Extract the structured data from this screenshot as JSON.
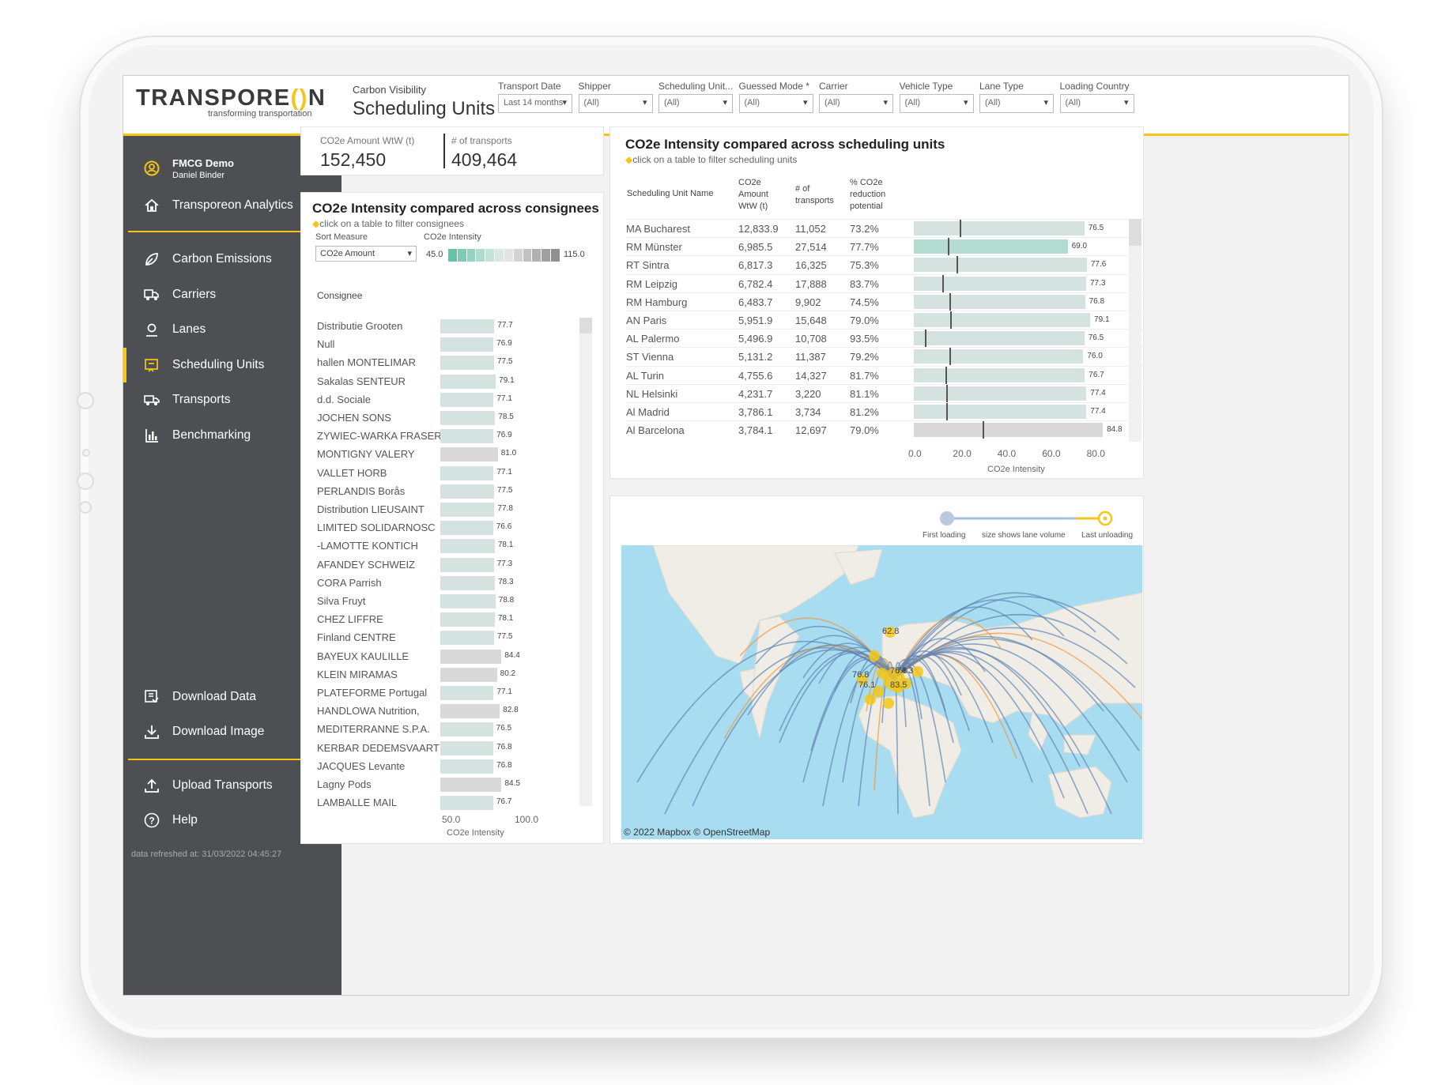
{
  "brand": {
    "logo_pre": "TRANSPORE",
    "logo_o": "()",
    "logo_post": "N",
    "tagline": "transforming transportation"
  },
  "page": {
    "subtitle": "Carbon Visibility",
    "title": "Scheduling Units"
  },
  "filters": [
    {
      "label": "Transport Date",
      "value": "Last 14 months"
    },
    {
      "label": "Shipper",
      "value": "(All)"
    },
    {
      "label": "Scheduling Unit...",
      "value": "(All)"
    },
    {
      "label": "Guessed Mode *",
      "value": "(All)"
    },
    {
      "label": "Carrier",
      "value": "(All)"
    },
    {
      "label": "Vehicle Type",
      "value": "(All)"
    },
    {
      "label": "Lane Type",
      "value": "(All)"
    },
    {
      "label": "Loading Country",
      "value": "(All)"
    }
  ],
  "user": {
    "org": "FMCG Demo",
    "name": "Daniel Binder"
  },
  "nav": {
    "home": "Transporeon Analytics",
    "items": [
      "Carbon Emissions",
      "Carriers",
      "Lanes",
      "Scheduling Units",
      "Transports",
      "Benchmarking"
    ],
    "active": "Scheduling Units",
    "download_data": "Download Data",
    "download_image": "Download Image",
    "upload": "Upload Transports",
    "help": "Help"
  },
  "refresh": "data refreshed at: 31/03/2022 04:45:27",
  "kpis": [
    {
      "label": "CO2e Amount WtW (t)",
      "value": "152,450"
    },
    {
      "label": "# of transports",
      "value": "409,464"
    }
  ],
  "consignees": {
    "title": "CO2e Intensity compared across consignees",
    "hint": "click on a table to filter consignees",
    "sort_label": "Sort Measure",
    "sort_value": "CO2e Amount",
    "legend_label": "CO2e Intensity",
    "legend_min": "45.0",
    "legend_max": "115.0",
    "col_header": "Consignee",
    "axis_ticks": [
      "50.0",
      "100.0"
    ],
    "axis_title": "CO2e Intensity",
    "rows": [
      {
        "name": "Distributie Grooten",
        "value": 77.7,
        "label": "77.7"
      },
      {
        "name": "Null",
        "value": 76.9,
        "label": "76.9"
      },
      {
        "name": "hallen MONTELIMAR",
        "value": 77.5,
        "label": "77.5"
      },
      {
        "name": "Sakalas SENTEUR",
        "value": 79.1,
        "label": "79.1"
      },
      {
        "name": "d.d. Sociale",
        "value": 77.1,
        "label": "77.1"
      },
      {
        "name": "JOCHEN SONS",
        "value": 78.5,
        "label": "78.5"
      },
      {
        "name": "ZYWIEC-WARKA FRASER",
        "value": 76.9,
        "label": "76.9"
      },
      {
        "name": "MONTIGNY VALERY",
        "value": 81.0,
        "label": "81.0",
        "grey": true
      },
      {
        "name": "VALLET HORB",
        "value": 77.1,
        "label": "77.1"
      },
      {
        "name": "PERLANDIS Borås",
        "value": 77.5,
        "label": "77.5"
      },
      {
        "name": "Distribution LIEUSAINT",
        "value": 77.8,
        "label": "77.8"
      },
      {
        "name": "LIMITED SOLIDARNOSC",
        "value": 76.6,
        "label": "76.6"
      },
      {
        "name": "-LAMOTTE KONTICH",
        "value": 78.1,
        "label": "78.1"
      },
      {
        "name": "AFANDEY SCHWEIZ",
        "value": 77.3,
        "label": "77.3"
      },
      {
        "name": "CORA Parrish",
        "value": 78.3,
        "label": "78.3"
      },
      {
        "name": "Silva Fruyt",
        "value": 78.8,
        "label": "78.8"
      },
      {
        "name": "CHEZ LIFFRE",
        "value": 78.1,
        "label": "78.1"
      },
      {
        "name": "Finland CENTRE",
        "value": 77.5,
        "label": "77.5"
      },
      {
        "name": "BAYEUX KAULILLE",
        "value": 84.4,
        "label": "84.4",
        "grey": true
      },
      {
        "name": "KLEIN MIRAMAS",
        "value": 80.2,
        "label": "80.2",
        "grey": true
      },
      {
        "name": "PLATEFORME Portugal",
        "value": 77.1,
        "label": "77.1"
      },
      {
        "name": "HANDLOWA Nutrition,",
        "value": 82.8,
        "label": "82.8",
        "grey": true
      },
      {
        "name": "MEDITERRANNE S.P.A.",
        "value": 76.5,
        "label": "76.5"
      },
      {
        "name": "KERBAR DEDEMSVAART",
        "value": 76.8,
        "label": "76.8"
      },
      {
        "name": "JACQUES Levante",
        "value": 76.8,
        "label": "76.8"
      },
      {
        "name": "Lagny Pods",
        "value": 84.5,
        "label": "84.5",
        "grey": true
      },
      {
        "name": "LAMBALLE MAIL",
        "value": 76.7,
        "label": "76.7"
      }
    ]
  },
  "units": {
    "title": "CO2e Intensity compared across scheduling units",
    "hint": "click on a table to filter scheduling units",
    "headers": {
      "name": "Scheduling Unit Name",
      "amount": "CO2e Amount WtW (t)",
      "transports": "# of transports",
      "reduction": "% CO2e reduction potential"
    },
    "axis_ticks": [
      "0.0",
      "20.0",
      "40.0",
      "60.0",
      "80.0"
    ],
    "axis_title": "CO2e Intensity",
    "rows": [
      {
        "name": "MA Bucharest",
        "amount": "12,833.9",
        "transports": "11,052",
        "reduction": "73.2%",
        "value": 76.5,
        "label": "76.5",
        "ref": 20.5
      },
      {
        "name": "RM Münster",
        "amount": "6,985.5",
        "transports": "27,514",
        "reduction": "77.7%",
        "value": 69.0,
        "label": "69.0",
        "ref": 15.4,
        "hl": true
      },
      {
        "name": "RT Sintra",
        "amount": "6,817.3",
        "transports": "16,325",
        "reduction": "75.3%",
        "value": 77.6,
        "label": "77.6",
        "ref": 19.2
      },
      {
        "name": "RM Leipzig",
        "amount": "6,782.4",
        "transports": "17,888",
        "reduction": "83.7%",
        "value": 77.3,
        "label": "77.3",
        "ref": 12.6
      },
      {
        "name": "RM Hamburg",
        "amount": "6,483.7",
        "transports": "9,902",
        "reduction": "74.5%",
        "value": 76.8,
        "label": "76.8",
        "ref": 16.1
      },
      {
        "name": "AN Paris",
        "amount": "5,951.9",
        "transports": "15,648",
        "reduction": "79.0%",
        "value": 79.1,
        "label": "79.1",
        "ref": 16.4
      },
      {
        "name": "AL Palermo",
        "amount": "5,496.9",
        "transports": "10,708",
        "reduction": "93.5%",
        "value": 76.5,
        "label": "76.5",
        "ref": 4.8
      },
      {
        "name": "ST Vienna",
        "amount": "5,131.2",
        "transports": "11,387",
        "reduction": "79.2%",
        "value": 76.0,
        "label": "76.0",
        "ref": 15.8
      },
      {
        "name": "AL Turin",
        "amount": "4,755.6",
        "transports": "14,327",
        "reduction": "81.7%",
        "value": 76.7,
        "label": "76.7",
        "ref": 14.1
      },
      {
        "name": "NL Helsinki",
        "amount": "4,231.7",
        "transports": "3,220",
        "reduction": "81.1%",
        "value": 77.4,
        "label": "77.4",
        "ref": 14.6
      },
      {
        "name": "Al Madrid",
        "amount": "3,786.1",
        "transports": "3,734",
        "reduction": "81.2%",
        "value": 77.4,
        "label": "77.4",
        "ref": 14.5
      },
      {
        "name": "Al Barcelona",
        "amount": "3,784.1",
        "transports": "12,697",
        "reduction": "79.0%",
        "value": 84.8,
        "label": "84.8",
        "ref": 30.9,
        "grey": true
      }
    ]
  },
  "map": {
    "legend_first": "First loading",
    "legend_size": "size shows lane volume",
    "legend_last": "Last unloading",
    "credit": "© 2022 Mapbox  © OpenStreetMap",
    "labels": [
      "62.8",
      "76.8",
      "74.3",
      "76.8",
      "76.1",
      "83.5"
    ]
  }
}
